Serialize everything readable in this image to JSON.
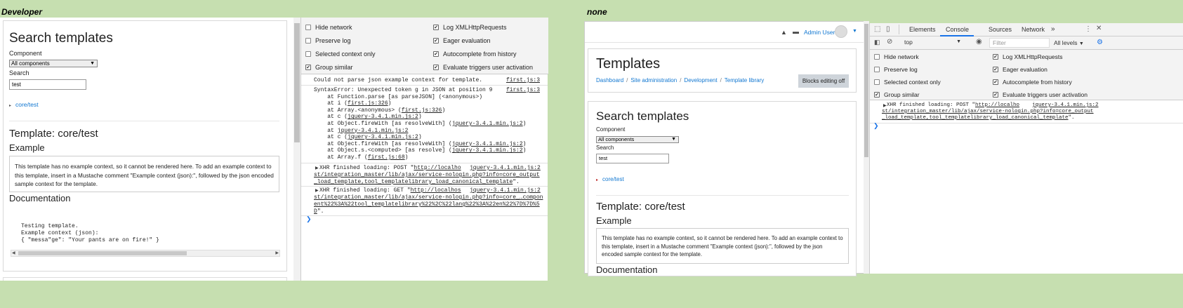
{
  "left": {
    "caption": "Developer",
    "page": {
      "search_title": "Search templates",
      "component_label": "Component",
      "component_value": "All components",
      "search_label": "Search",
      "search_value": "test",
      "result_link": "core/test",
      "template_title": "Template: core/test",
      "example_heading": "Example",
      "example_text": "This template has no example context, so it cannot be rendered here. To add an example context to this template, insert in a Mustache comment \"Example context (json):\", followed by the json encoded sample context for the template.",
      "doc_heading": "Documentation",
      "doc_lines": [
        "Testing template.",
        "",
        "Example context (json):",
        "{ \"messa\"ge\": \"Your pants are on fire!\" }"
      ]
    },
    "devtools": {
      "options_left": [
        {
          "label": "Hide network",
          "checked": false
        },
        {
          "label": "Preserve log",
          "checked": false
        },
        {
          "label": "Selected context only",
          "checked": false
        },
        {
          "label": "Group similar",
          "checked": true
        }
      ],
      "options_right": [
        {
          "label": "Log XMLHttpRequests",
          "checked": true
        },
        {
          "label": "Eager evaluation",
          "checked": true
        },
        {
          "label": "Autocomplete from history",
          "checked": true
        },
        {
          "label": "Evaluate triggers user activation",
          "checked": true
        }
      ],
      "msg1": "Could not parse json example context for template.",
      "msg1_src": "first.js:3",
      "msg2_head": "SyntaxError: Unexpected token g in JSON at position 9",
      "msg2_src": "first.js:3",
      "stack": [
        {
          "text": "    at Function.parse [as parseJSON] (<anonymous>)",
          "link": ""
        },
        {
          "text": "    at i (",
          "link": "first.js:326",
          "tail": ")"
        },
        {
          "text": "    at Array.<anonymous> (",
          "link": "first.js:326",
          "tail": ")"
        },
        {
          "text": "    at c (",
          "link": "jquery-3.4.1.min.js:2",
          "tail": ")"
        },
        {
          "text": "    at Object.fireWith [as resolveWith] (",
          "link": "jquery-3.4.1.min.js:2",
          "tail": ")"
        },
        {
          "text": "    at ",
          "link": "jquery-3.4.1.min.js:2",
          "tail": ""
        },
        {
          "text": "    at c (",
          "link": "jquery-3.4.1.min.js:2",
          "tail": ")"
        },
        {
          "text": "    at Object.fireWith [as resolveWith] (",
          "link": "jquery-3.4.1.min.js:2",
          "tail": ")"
        },
        {
          "text": "    at Object.s.<computed> [as resolve] (",
          "link": "jquery-3.4.1.min.js:2",
          "tail": ")"
        },
        {
          "text": "    at Array.f (",
          "link": "first.js:68",
          "tail": ")"
        }
      ],
      "xhr1_prefix": "XHR finished loading: POST \"",
      "xhr1_link_a": "http://localho",
      "xhr1_src": "jquery-3.4.1.min.js:2",
      "xhr1_line2": "st/integration_master/lib/ajax/service-nologin.php?info=core_output",
      "xhr1_line3": "_load_template,tool_templatelibrary_load_canonical_template",
      "xhr1_end": "\".",
      "xhr2_prefix": "XHR finished loading: GET \"",
      "xhr2_link_a": "http://localhos",
      "xhr2_src": "jquery-3.4.1.min.js:2",
      "xhr2_line2": "st/integration_master/lib/ajax/service-nologin.php?info=core_…compon",
      "xhr2_line3": "ent%22%3A%22tool_templatelibrary%22%2C%22lang%22%3A%22en%22%7D%7D%5",
      "xhr2_line4": "D",
      "xhr2_end": "\"."
    }
  },
  "right": {
    "caption": "none",
    "user_name": "Admin User",
    "page": {
      "title": "Templates",
      "breadcrumb": [
        "Dashboard",
        "Site administration",
        "Development",
        "Template library"
      ],
      "blocks_button": "Blocks editing off",
      "search_title": "Search templates",
      "component_label": "Component",
      "component_value": "All components",
      "search_label": "Search",
      "search_value": "test",
      "result_link": "core/test",
      "template_title": "Template: core/test",
      "example_heading": "Example",
      "example_text": "This template has no example context, so it cannot be rendered here. To add an example context to this template, insert in a Mustache comment \"Example context (json):\", followed by the json encoded sample context for the template.",
      "doc_heading": "Documentation"
    },
    "devtools": {
      "tabs": [
        "Elements",
        "Console",
        "Sources",
        "Network"
      ],
      "active_tab": "Console",
      "more_tabs": "»",
      "context": "top",
      "filter_placeholder": "Filter",
      "levels": "All levels",
      "options_left": [
        {
          "label": "Hide network",
          "checked": false
        },
        {
          "label": "Preserve log",
          "checked": false
        },
        {
          "label": "Selected context only",
          "checked": false
        },
        {
          "label": "Group similar",
          "checked": true
        }
      ],
      "options_right": [
        {
          "label": "Log XMLHttpRequests",
          "checked": true
        },
        {
          "label": "Eager evaluation",
          "checked": true
        },
        {
          "label": "Autocomplete from history",
          "checked": true
        },
        {
          "label": "Evaluate triggers user activation",
          "checked": true
        }
      ],
      "xhr_prefix": "XHR finished loading: POST \"",
      "xhr_link_a": "http://localho",
      "xhr_src": "jquery-3.4.1.min.js:2",
      "xhr_line2": "st/integration_master/lib/ajax/service-nologin.php?info=core_output",
      "xhr_line3": "_load_template,tool_templatelibrary_load_canonical_template",
      "xhr_end": "\"."
    }
  }
}
